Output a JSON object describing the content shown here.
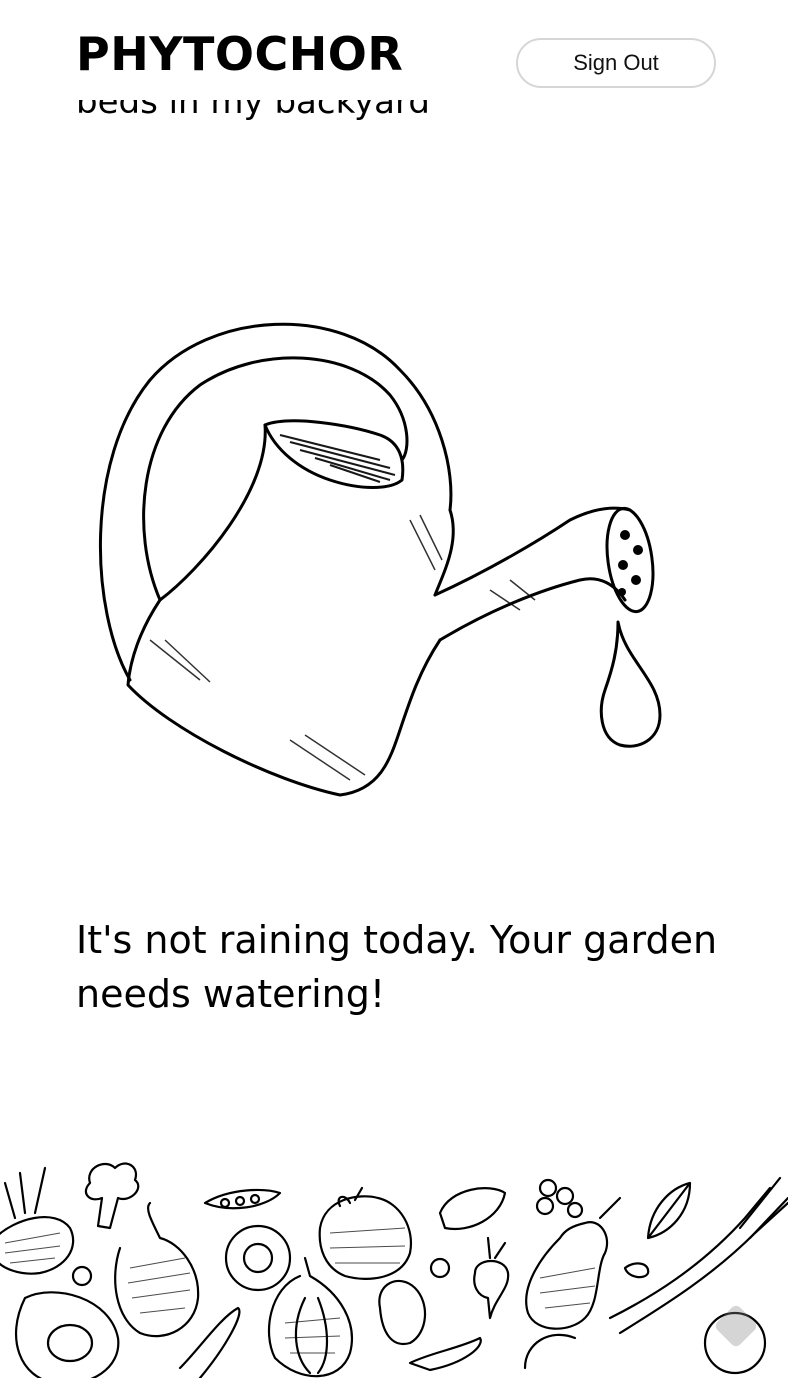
{
  "header": {
    "brand": "PHYTOCHOR",
    "sign_out_label": "Sign Out"
  },
  "main": {
    "scrolled_text_fragment": "beds in my backyard",
    "illustration_icon": "watering-can-icon",
    "message": "It's not raining today. Your garden needs watering!"
  },
  "footer": {
    "illustration": "vegetables-pattern",
    "scroll_top_icon": "scroll-to-top-icon"
  }
}
